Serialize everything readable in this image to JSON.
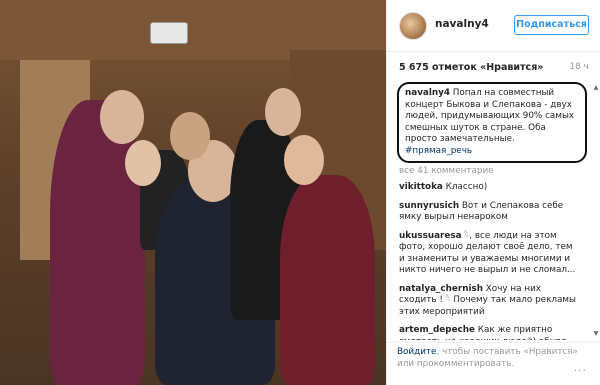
{
  "post": {
    "photo_alt": "",
    "header": {
      "username": "navalny4",
      "follow_label": "Подписаться"
    },
    "stats": {
      "likes": "5 675 отметок «Нравится»",
      "time": "18 ч"
    },
    "caption": {
      "username": "navalny4",
      "text": " Попал на совместный концерт Быкова и Слепакова - двух людей, придумывающих 90% самых смешных шуток в стране. Оба просто замечательные. ",
      "hashtag": "#прямая_речь"
    },
    "view_all": "все 41 комментарие",
    "comments": [
      {
        "username": "vikittoka",
        "text": " Классно)"
      },
      {
        "username": "sunnyrusich",
        "text": " Вот и Слепакова себе ямку вырыл ненароком"
      },
      {
        "username": "ukussuaresa",
        "text": " 𓆩, все люди на этом фото, хорошо делают своё дело, тем и знамениты и уважаемы многими и никто ничего не вырыл и не сломал..."
      },
      {
        "username": "natalya_chernish",
        "text": " Хочу на них сходить ! 𓆩 Почему так мало рекламы этих мероприятий"
      },
      {
        "username": "artem_depeche",
        "text": " Как же приятно смотреть на хороших людей) обнял бы всех))"
      }
    ],
    "footer": {
      "login": "Войдите",
      "text": ", чтобы поставить «Нравится» или прокомментировать.",
      "more_icon": "···"
    }
  }
}
